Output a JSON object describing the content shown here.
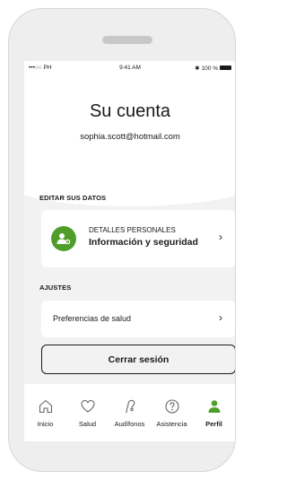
{
  "status_bar": {
    "carrier": "•••○○ PH",
    "time": "9:41 AM",
    "battery": "100 %"
  },
  "header": {
    "title": "Su cuenta",
    "email": "sophia.scott@hotmail.com"
  },
  "edit_section": {
    "label": "EDITAR SUS DATOS",
    "personal_card": {
      "kicker": "DETALLES PERSONALES",
      "title": "Información y seguridad",
      "chevron": "›"
    }
  },
  "settings_section": {
    "label": "AJUSTES",
    "health_card": {
      "label": "Preferencias de salud",
      "chevron": "›"
    }
  },
  "logout_button": "Cerrar sesión",
  "tabbar": {
    "active_color": "#4f9e2a",
    "tabs": [
      {
        "label": "Inicio",
        "icon": "home-icon",
        "active": false
      },
      {
        "label": "Salud",
        "icon": "heart-icon",
        "active": false
      },
      {
        "label": "Audífonos",
        "icon": "hearing-aid-icon",
        "active": false
      },
      {
        "label": "Asistencia",
        "icon": "help-icon",
        "active": false
      },
      {
        "label": "Perfil",
        "icon": "person-icon",
        "active": true
      }
    ]
  }
}
